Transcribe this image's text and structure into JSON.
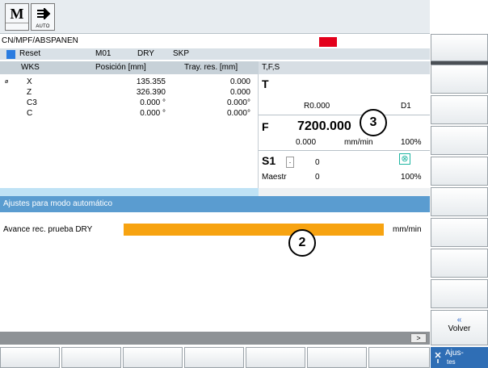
{
  "topbar": {
    "machine_letter": "M",
    "mode_label": "AUTO"
  },
  "path": "CN/MPF/ABSPANEN",
  "status": {
    "reset": "Reset",
    "m01": "M01",
    "dry": "DRY",
    "skp": "SKP"
  },
  "wks": {
    "title": "WKS",
    "col_pos": "Posición [mm]",
    "col_tray": "Tray. res. [mm]",
    "rows": [
      {
        "axis": "X",
        "pos": "135.355",
        "tray": "0.000"
      },
      {
        "axis": "Z",
        "pos": "326.390",
        "tray": "0.000"
      },
      {
        "axis": "C3",
        "pos": "0.000 °",
        "tray": "0.000°"
      },
      {
        "axis": "C",
        "pos": "0.000 °",
        "tray": "0.000°"
      }
    ]
  },
  "tfs": {
    "title": "T,F,S",
    "t_label": "T",
    "radius": "R0.000",
    "d": "D1",
    "f_label": "F",
    "feed": "7200.000",
    "feed_act": "0.000",
    "feed_unit": "mm/min",
    "feed_pct": "100%",
    "s_label": "S1",
    "s_val": "0",
    "maestr": "Maestr",
    "maestr_val": "0",
    "s_pct": "100%"
  },
  "ajustes": {
    "title": "Ajustes para modo automático",
    "avance_label": "Avance rec. prueba  DRY",
    "avance_unit": "mm/min"
  },
  "callouts": {
    "c2": "2",
    "c3": "3"
  },
  "softkeys": {
    "volver_arrow": "«",
    "volver": "Volver",
    "ajustes": "Ajus-",
    "ajustes2": "tes",
    "scroll": ">"
  },
  "colors": {
    "accent": "#5a9cd0",
    "orange": "#f7a311",
    "alarm": "#e3001b"
  }
}
